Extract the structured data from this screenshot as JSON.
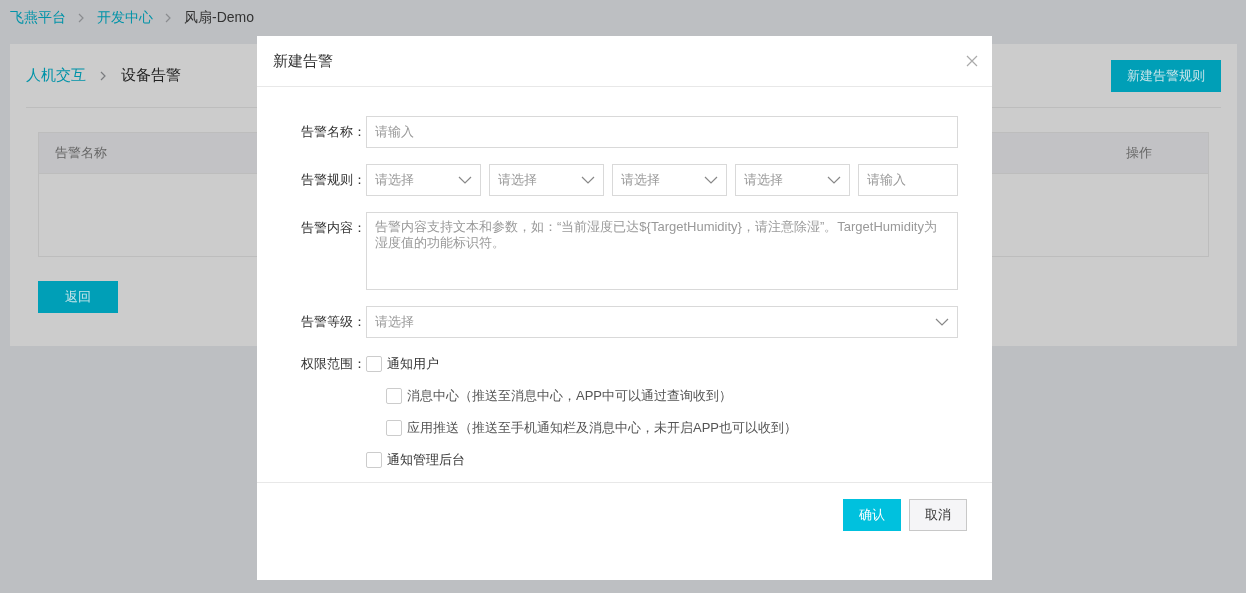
{
  "breadcrumb": [
    {
      "label": "飞燕平台",
      "link": true
    },
    {
      "label": "开发中心",
      "link": true
    },
    {
      "label": "风扇-Demo",
      "link": false
    }
  ],
  "page": {
    "breadcrumb": [
      {
        "label": "人机交互",
        "link": true
      },
      {
        "label": "设备告警",
        "link": false
      }
    ],
    "new_button": "新建告警规则",
    "table": {
      "columns": [
        "告警名称",
        "操作"
      ]
    },
    "back_button": "返回"
  },
  "dialog": {
    "title": "新建告警",
    "fields": [
      {
        "kind": "input",
        "label": "告警名称：",
        "placeholder": "请输入"
      },
      {
        "kind": "rule",
        "label": "告警规则：",
        "parts": [
          {
            "kind": "select",
            "placeholder": "请选择"
          },
          {
            "kind": "select",
            "placeholder": "请选择"
          },
          {
            "kind": "select",
            "placeholder": "请选择"
          },
          {
            "kind": "select",
            "placeholder": "请选择"
          },
          {
            "kind": "input",
            "placeholder": "请输入"
          }
        ]
      },
      {
        "kind": "textarea",
        "label": "告警内容：",
        "placeholder": "告警内容支持文本和参数，如：“当前湿度已达${TargetHumidity}，请注意除湿”。TargetHumidity为湿度值的功能标识符。"
      },
      {
        "kind": "select",
        "label": "告警等级：",
        "placeholder": "请选择"
      }
    ],
    "scope": {
      "label": "权限范围：",
      "options": [
        {
          "label": "通知用户",
          "checked": false,
          "children": [
            {
              "label": "消息中心（推送至消息中心，APP中可以通过查询收到）",
              "checked": false
            },
            {
              "label": "应用推送（推送至手机通知栏及消息中心，未开启APP也可以收到）",
              "checked": false
            }
          ]
        },
        {
          "label": "通知管理后台",
          "checked": false
        }
      ]
    },
    "buttons": {
      "confirm": "确认",
      "cancel": "取消"
    }
  }
}
